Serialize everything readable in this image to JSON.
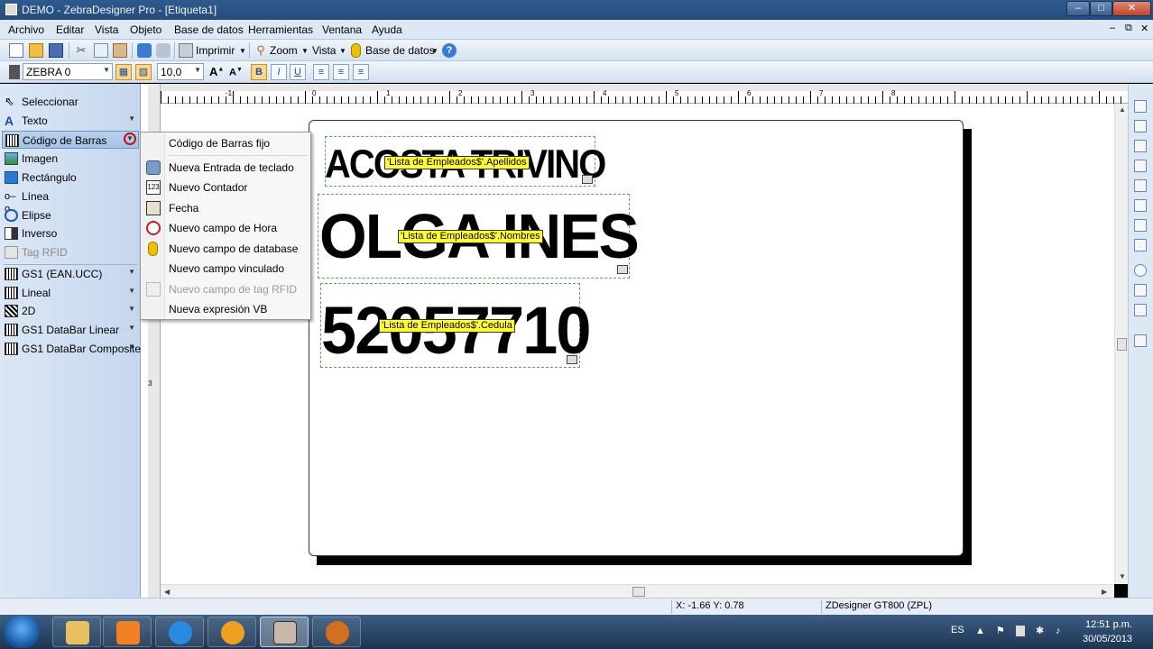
{
  "window": {
    "title": "DEMO - ZebraDesigner Pro - [Etiqueta1]",
    "min_glyph": "–",
    "max_glyph": "□",
    "close_glyph": "✕"
  },
  "menubar": {
    "items": [
      "Archivo",
      "Editar",
      "Vista",
      "Objeto",
      "Base de datos",
      "Herramientas",
      "Ventana",
      "Ayuda"
    ],
    "mdi_min": "–",
    "mdi_restore": "⧉",
    "mdi_close": "✕"
  },
  "toolbar1": {
    "print_label": "Imprimir",
    "zoom_label": "Zoom",
    "view_label": "Vista",
    "database_label": "Base de datos",
    "help_glyph": "?"
  },
  "toolbar2": {
    "font_name": "ZEBRA 0",
    "font_size": "10,0",
    "bold": "B",
    "italic": "I",
    "underline": "U"
  },
  "tools": [
    {
      "label": "Seleccionar",
      "icon": "pointer-icon"
    },
    {
      "label": "Texto",
      "icon": "text-icon"
    },
    {
      "label": "Código de Barras",
      "icon": "barcode-icon"
    },
    {
      "label": "Imagen",
      "icon": "image-icon"
    },
    {
      "label": "Rectángulo",
      "icon": "rectangle-icon"
    },
    {
      "label": "Línea",
      "icon": "line-icon"
    },
    {
      "label": "Elipse",
      "icon": "ellipse-icon"
    },
    {
      "label": "Inverso",
      "icon": "inverse-icon"
    },
    {
      "label": "Tag RFID",
      "icon": "rfid-icon"
    }
  ],
  "barcode_groups": [
    {
      "label": "GS1 (EAN.UCC)"
    },
    {
      "label": "Lineal"
    },
    {
      "label": "2D"
    },
    {
      "label": "GS1 DataBar Linear"
    },
    {
      "label": "GS1 DataBar Composite"
    }
  ],
  "dropdown": {
    "items": [
      {
        "label": "Código de Barras fijo",
        "icon": ""
      },
      {
        "label": "Nueva Entrada de teclado",
        "icon": "keyboard-input-icon"
      },
      {
        "label": "Nuevo Contador",
        "icon": "counter-icon"
      },
      {
        "label": "Fecha",
        "icon": "calendar-icon"
      },
      {
        "label": "Nuevo campo de Hora",
        "icon": "clock-icon"
      },
      {
        "label": "Nuevo campo de database",
        "icon": "database-icon"
      },
      {
        "label": "Nuevo campo vinculado",
        "icon": ""
      },
      {
        "label": "Nuevo campo de tag RFID",
        "icon": "rfid-icon"
      },
      {
        "label": "Nueva expresión VB",
        "icon": ""
      }
    ]
  },
  "ruler": {
    "h_numbers": [
      "-1",
      "0",
      "1",
      "2",
      "3",
      "4",
      "5",
      "6",
      "7",
      "8"
    ],
    "v_numbers": [
      "1",
      "2",
      "3"
    ]
  },
  "label": {
    "fields": [
      {
        "text": "ACOSTA TRIVINO",
        "tag": "'Lista de Empleados$'.Apellidos"
      },
      {
        "text": "OLGA INES",
        "tag": "'Lista de Empleados$'.Nombres"
      },
      {
        "text": "52057710",
        "tag": "'Lista de Empleados$'.Cedula"
      }
    ]
  },
  "statusbar": {
    "coords": "X: -1.66 Y:  0.78",
    "printer": "ZDesigner GT800 (ZPL)"
  },
  "taskbar": {
    "language": "ES",
    "time": "12:51 p.m.",
    "date": "30/05/2013"
  }
}
